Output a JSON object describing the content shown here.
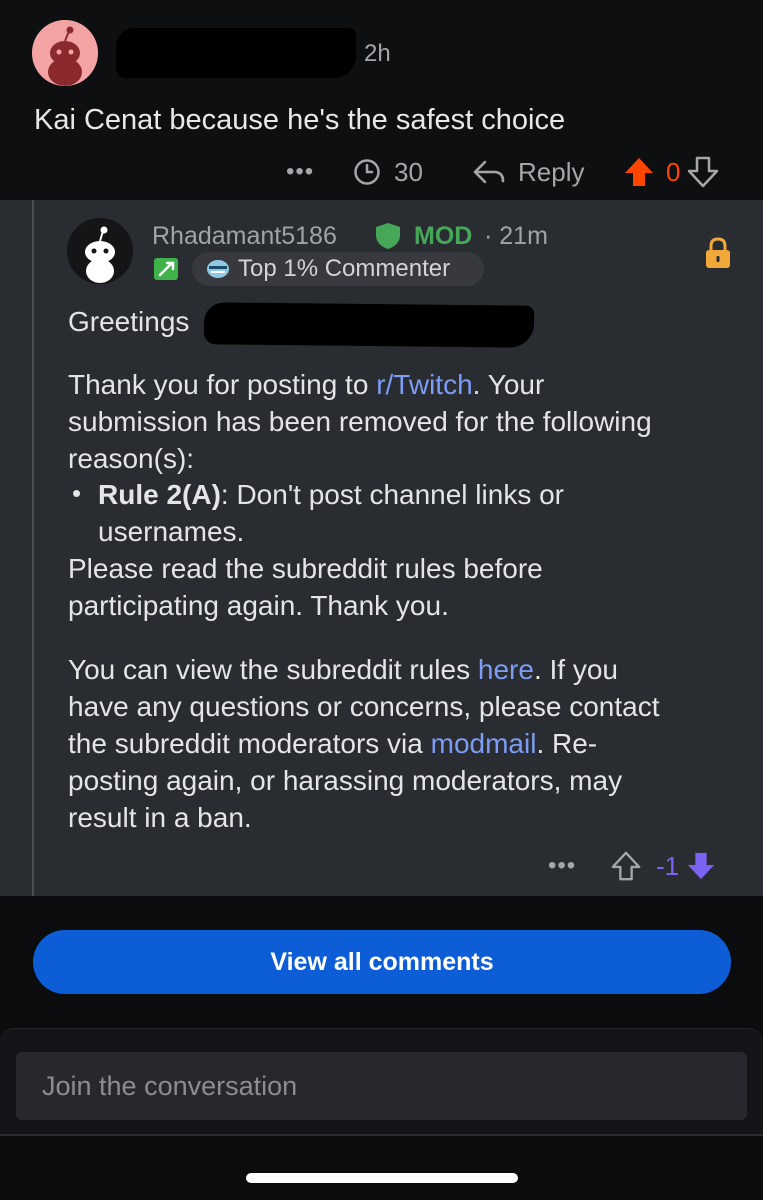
{
  "top_comment": {
    "time": "2h",
    "body": "Kai Cenat because he's the safest choice",
    "comment_count": "30",
    "reply_label": "Reply",
    "vote_count": "0"
  },
  "mod_reply": {
    "username": "Rhadamant5186",
    "mod_label": "MOD",
    "time": "· 21m",
    "flair": "Top 1% Commenter",
    "greeting": "Greetings",
    "para1_a": "Thank you for posting to ",
    "para1_link": "r/Twitch",
    "para1_b": ". Your",
    "para1_line2": "submission has been removed for the following",
    "para1_line3": "reason(s):",
    "bullet_char": "•",
    "rule_bold": "Rule 2(A)",
    "rule_text": ": Don't post channel links or",
    "rule_line2": "usernames.",
    "para2_line1": "Please read the subreddit rules before",
    "para2_line2": "participating again. Thank you.",
    "para3_a": "You can view the subreddit rules ",
    "para3_link1": "here",
    "para3_b": ". If you",
    "para3_line2": "have any questions or concerns, please contact",
    "para3_line3a": "the subreddit moderators via ",
    "para3_link2": "modmail",
    "para3_line3b": ". Re-",
    "para3_line4": "posting again, or harassing moderators, may",
    "para3_line5": "result in a ban.",
    "vote_count": "-1"
  },
  "view_all_label": "View all comments",
  "composer_placeholder": "Join the conversation",
  "colors": {
    "upvote_orange": "#ff4500",
    "downvote_purple": "#7b62f0",
    "mod_green": "#46a758",
    "link_blue": "#7c9cf5",
    "button_blue": "#0d5ed6",
    "lock_yellow": "#f2a93b"
  },
  "icons": [
    "snoo-avatar-icon",
    "comment-icon",
    "reply-arrow-icon",
    "upvote-icon",
    "downvote-icon",
    "mod-shield-icon",
    "flair-sword-icon",
    "achievement-icon",
    "lock-icon",
    "more-options-icon"
  ]
}
